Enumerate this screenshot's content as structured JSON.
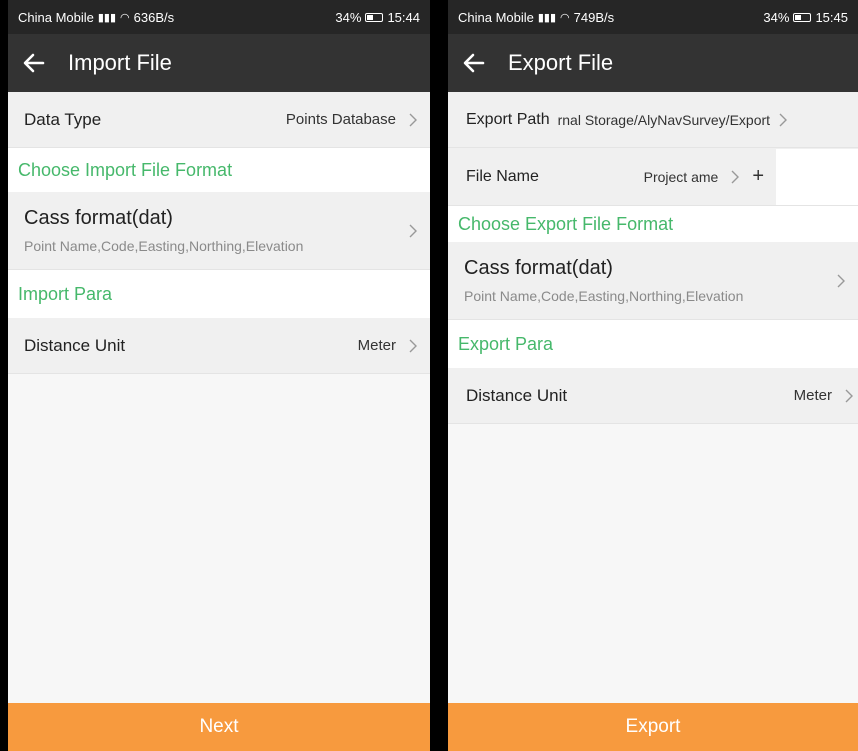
{
  "import_screen": {
    "status": {
      "carrier": "China Mobile",
      "speed": "636B/s",
      "battery": "34%",
      "time": "15:44"
    },
    "title": "Import File",
    "data_type": {
      "label": "Data Type",
      "value": "Points Database"
    },
    "format_section": "Choose Import File Format",
    "format": {
      "name": "Cass format(dat)",
      "fields": "Point Name,Code,Easting,Northing,Elevation"
    },
    "para_section": "Import Para",
    "distance_unit": {
      "label": "Distance Unit",
      "value": "Meter"
    },
    "button": "Next"
  },
  "export_screen": {
    "status": {
      "carrier": "China Mobile",
      "speed": "749B/s",
      "battery": "34%",
      "time": "15:45"
    },
    "title": "Export File",
    "export_path": {
      "label": "Export Path",
      "value": "rnal Storage/AlyNavSurvey/Export"
    },
    "file_name": {
      "label": "File Name",
      "value": "Project ame",
      "plus": "+",
      "input_value": ""
    },
    "format_section": "Choose Export File Format",
    "format": {
      "name": "Cass format(dat)",
      "fields": "Point Name,Code,Easting,Northing,Elevation"
    },
    "para_section": "Export Para",
    "distance_unit": {
      "label": "Distance Unit",
      "value": "Meter"
    },
    "button": "Export"
  },
  "colors": {
    "accent_orange": "#f79a3e",
    "section_green": "#46b86b",
    "appbar": "#333333",
    "statusbar": "#262626"
  },
  "icons": [
    "back-arrow-icon",
    "chevron-right-icon",
    "signal-icon",
    "wifi-icon",
    "battery-icon"
  ]
}
